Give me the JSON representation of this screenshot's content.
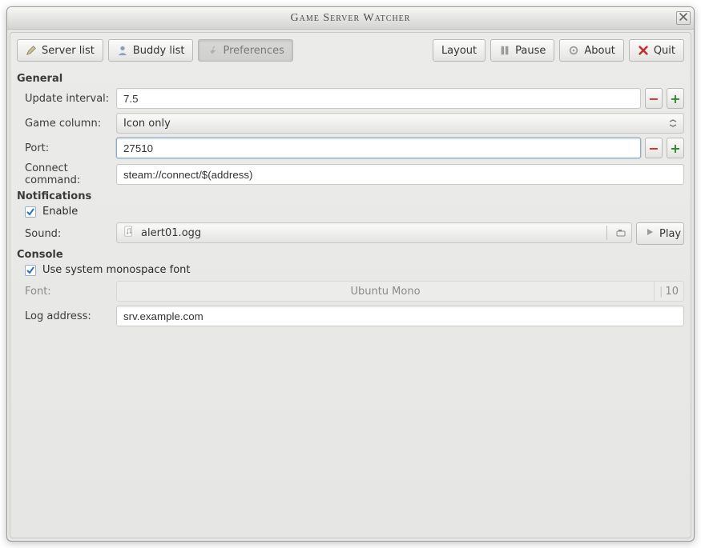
{
  "title": "Game Server Watcher",
  "toolbar": {
    "server_list": "Server list",
    "buddy_list": "Buddy list",
    "preferences": "Preferences",
    "layout": "Layout",
    "pause": "Pause",
    "about": "About",
    "quit": "Quit"
  },
  "sections": {
    "general": {
      "heading": "General",
      "update_interval_label": "Update interval:",
      "update_interval_value": "7.5",
      "game_column_label": "Game column:",
      "game_column_value": "Icon only",
      "port_label": "Port:",
      "port_value": "27510",
      "connect_command_label": "Connect command:",
      "connect_command_value": "steam://connect/$(address)"
    },
    "notifications": {
      "heading": "Notifications",
      "enable_label": "Enable",
      "enable_checked": true,
      "sound_label": "Sound:",
      "sound_file": "alert01.ogg",
      "play_label": "Play"
    },
    "console": {
      "heading": "Console",
      "monospace_label": "Use system monospace font",
      "monospace_checked": true,
      "font_label": "Font:",
      "font_name": "Ubuntu Mono",
      "font_size": "10",
      "log_address_label": "Log address:",
      "log_address_value": "srv.example.com"
    }
  }
}
